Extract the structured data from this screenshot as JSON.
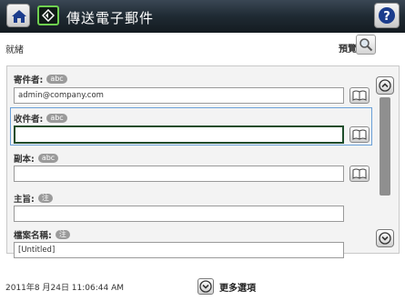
{
  "header": {
    "title": "傳送電子郵件"
  },
  "status": {
    "text": "就緒",
    "preview_label": "預覽"
  },
  "form": {
    "from": {
      "label": "寄件者:",
      "badge": "abc",
      "value": "admin@company.com"
    },
    "to": {
      "label": "收件者:",
      "badge": "abc",
      "value": ""
    },
    "cc": {
      "label": "副本:",
      "badge": "abc",
      "value": ""
    },
    "subject": {
      "label": "主旨:",
      "badge": "注",
      "value": ""
    },
    "filename": {
      "label": "檔案名稱:",
      "badge": "注",
      "value": "[Untitled]"
    }
  },
  "footer": {
    "timestamp": "2011年8 月24日 11:06:44 AM",
    "more_options": "更多選項"
  },
  "icons": {
    "home": "home-icon",
    "app": "send-email-icon",
    "help": "help-icon",
    "preview": "magnifier-icon",
    "address_book": "address-book-icon",
    "scroll_up": "chevron-up-icon",
    "scroll_down": "chevron-down-icon",
    "more": "chevron-down-icon"
  },
  "colors": {
    "topbar": "#1f2a33",
    "app_icon_accent": "#6fd050",
    "active_field_border": "#1e4d2b",
    "selection_border": "#6aa0d8"
  }
}
